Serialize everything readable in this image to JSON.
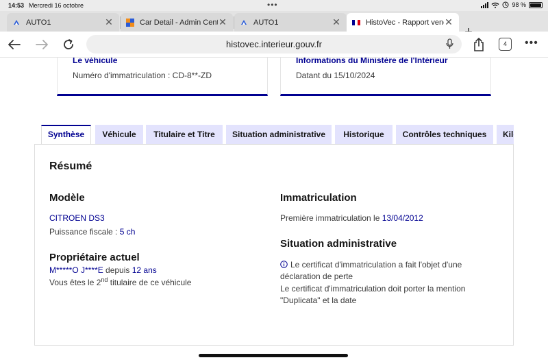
{
  "status": {
    "time": "14:53",
    "date": "Mercredi 16 octobre",
    "battery": "98 %"
  },
  "browser": {
    "tabs": [
      {
        "title": "AUTO1",
        "favicon": "auto1-logo-icon"
      },
      {
        "title": "Car Detail - Admin Cente",
        "favicon": "admin-logo-icon"
      },
      {
        "title": "AUTO1",
        "favicon": "auto1-logo-icon"
      },
      {
        "title": "HistoVec - Rapport vendeu",
        "favicon": "french-flag-icon",
        "active": true
      }
    ],
    "url": "histovec.interieur.gouv.fr",
    "tab_count": "4"
  },
  "cards": [
    {
      "title": "Le véhicule",
      "text": "Numéro d'immatriculation : CD-8**-ZD"
    },
    {
      "title": "Informations du Ministère de l'Intérieur",
      "text": "Datant du 15/10/2024"
    }
  ],
  "page_tabs": [
    {
      "label": "Synthèse",
      "active": true
    },
    {
      "label": "Véhicule"
    },
    {
      "label": "Titulaire et Titre"
    },
    {
      "label": "Situation administrative"
    },
    {
      "label": "Historique"
    },
    {
      "label": "Contrôles techniques"
    },
    {
      "label": "Kilo"
    }
  ],
  "resume": {
    "heading": "Résumé",
    "modele": {
      "heading": "Modèle",
      "value": "CITROEN DS3",
      "puissance_label": "Puissance fiscale : ",
      "puissance_value": "5 ch"
    },
    "proprietaire": {
      "heading": "Propriétaire actuel",
      "name": "M*****O J****E",
      "since_label": " depuis ",
      "since_value": "12 ans",
      "rank_prefix": "Vous êtes le 2",
      "rank_sup": "nd",
      "rank_suffix": " titulaire de ce véhicule"
    },
    "immatriculation": {
      "heading": "Immatriculation",
      "first_label": "Première immatriculation le ",
      "first_date": "13/04/2012"
    },
    "situation": {
      "heading": "Situation administrative",
      "line1": "Le certificat d'immatriculation a fait l'objet d'une",
      "line2": "déclaration de perte",
      "line3": "Le certificat d'immatriculation doit porter la mention",
      "line4": "\"Duplicata\" et la date"
    }
  },
  "colors": {
    "accent": "#000091",
    "tab_bg": "#e3e3fd"
  }
}
